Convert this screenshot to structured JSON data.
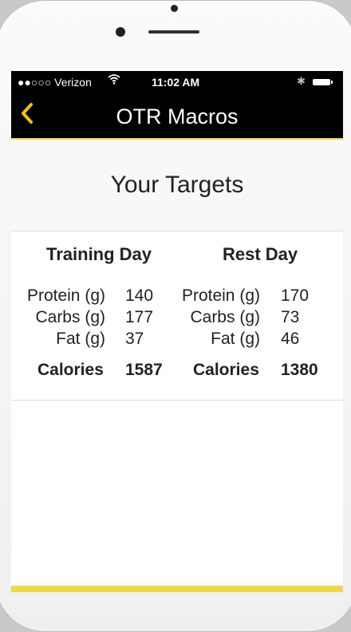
{
  "status_bar": {
    "carrier": "●●○○○ Verizon",
    "time": "11:02 AM"
  },
  "nav": {
    "back_icon": "chevron-left-icon",
    "title": "OTR Macros"
  },
  "header": {
    "title": "Your Targets"
  },
  "training_day": {
    "heading": "Training Day",
    "protein_label": "Protein (g)",
    "protein_value": "140",
    "carbs_label": "Carbs (g)",
    "carbs_value": "177",
    "fat_label": "Fat (g)",
    "fat_value": "37",
    "calories_label": "Calories",
    "calories_value": "1587"
  },
  "rest_day": {
    "heading": "Rest Day",
    "protein_label": "Protein (g)",
    "protein_value": "170",
    "carbs_label": "Carbs (g)",
    "carbs_value": "73",
    "fat_label": "Fat (g)",
    "fat_value": "46",
    "calories_label": "Calories",
    "calories_value": "1380"
  },
  "colors": {
    "accent": "#f2c500",
    "navbar": "#000000"
  }
}
